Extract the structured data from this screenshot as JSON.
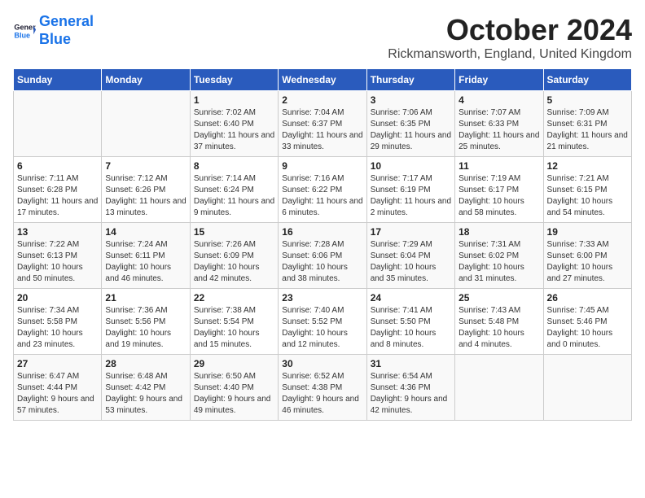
{
  "header": {
    "logo_line1": "General",
    "logo_line2": "Blue",
    "month_title": "October 2024",
    "location": "Rickmansworth, England, United Kingdom"
  },
  "weekdays": [
    "Sunday",
    "Monday",
    "Tuesday",
    "Wednesday",
    "Thursday",
    "Friday",
    "Saturday"
  ],
  "weeks": [
    [
      {
        "day": "",
        "info": ""
      },
      {
        "day": "",
        "info": ""
      },
      {
        "day": "1",
        "info": "Sunrise: 7:02 AM\nSunset: 6:40 PM\nDaylight: 11 hours and 37 minutes."
      },
      {
        "day": "2",
        "info": "Sunrise: 7:04 AM\nSunset: 6:37 PM\nDaylight: 11 hours and 33 minutes."
      },
      {
        "day": "3",
        "info": "Sunrise: 7:06 AM\nSunset: 6:35 PM\nDaylight: 11 hours and 29 minutes."
      },
      {
        "day": "4",
        "info": "Sunrise: 7:07 AM\nSunset: 6:33 PM\nDaylight: 11 hours and 25 minutes."
      },
      {
        "day": "5",
        "info": "Sunrise: 7:09 AM\nSunset: 6:31 PM\nDaylight: 11 hours and 21 minutes."
      }
    ],
    [
      {
        "day": "6",
        "info": "Sunrise: 7:11 AM\nSunset: 6:28 PM\nDaylight: 11 hours and 17 minutes."
      },
      {
        "day": "7",
        "info": "Sunrise: 7:12 AM\nSunset: 6:26 PM\nDaylight: 11 hours and 13 minutes."
      },
      {
        "day": "8",
        "info": "Sunrise: 7:14 AM\nSunset: 6:24 PM\nDaylight: 11 hours and 9 minutes."
      },
      {
        "day": "9",
        "info": "Sunrise: 7:16 AM\nSunset: 6:22 PM\nDaylight: 11 hours and 6 minutes."
      },
      {
        "day": "10",
        "info": "Sunrise: 7:17 AM\nSunset: 6:19 PM\nDaylight: 11 hours and 2 minutes."
      },
      {
        "day": "11",
        "info": "Sunrise: 7:19 AM\nSunset: 6:17 PM\nDaylight: 10 hours and 58 minutes."
      },
      {
        "day": "12",
        "info": "Sunrise: 7:21 AM\nSunset: 6:15 PM\nDaylight: 10 hours and 54 minutes."
      }
    ],
    [
      {
        "day": "13",
        "info": "Sunrise: 7:22 AM\nSunset: 6:13 PM\nDaylight: 10 hours and 50 minutes."
      },
      {
        "day": "14",
        "info": "Sunrise: 7:24 AM\nSunset: 6:11 PM\nDaylight: 10 hours and 46 minutes."
      },
      {
        "day": "15",
        "info": "Sunrise: 7:26 AM\nSunset: 6:09 PM\nDaylight: 10 hours and 42 minutes."
      },
      {
        "day": "16",
        "info": "Sunrise: 7:28 AM\nSunset: 6:06 PM\nDaylight: 10 hours and 38 minutes."
      },
      {
        "day": "17",
        "info": "Sunrise: 7:29 AM\nSunset: 6:04 PM\nDaylight: 10 hours and 35 minutes."
      },
      {
        "day": "18",
        "info": "Sunrise: 7:31 AM\nSunset: 6:02 PM\nDaylight: 10 hours and 31 minutes."
      },
      {
        "day": "19",
        "info": "Sunrise: 7:33 AM\nSunset: 6:00 PM\nDaylight: 10 hours and 27 minutes."
      }
    ],
    [
      {
        "day": "20",
        "info": "Sunrise: 7:34 AM\nSunset: 5:58 PM\nDaylight: 10 hours and 23 minutes."
      },
      {
        "day": "21",
        "info": "Sunrise: 7:36 AM\nSunset: 5:56 PM\nDaylight: 10 hours and 19 minutes."
      },
      {
        "day": "22",
        "info": "Sunrise: 7:38 AM\nSunset: 5:54 PM\nDaylight: 10 hours and 15 minutes."
      },
      {
        "day": "23",
        "info": "Sunrise: 7:40 AM\nSunset: 5:52 PM\nDaylight: 10 hours and 12 minutes."
      },
      {
        "day": "24",
        "info": "Sunrise: 7:41 AM\nSunset: 5:50 PM\nDaylight: 10 hours and 8 minutes."
      },
      {
        "day": "25",
        "info": "Sunrise: 7:43 AM\nSunset: 5:48 PM\nDaylight: 10 hours and 4 minutes."
      },
      {
        "day": "26",
        "info": "Sunrise: 7:45 AM\nSunset: 5:46 PM\nDaylight: 10 hours and 0 minutes."
      }
    ],
    [
      {
        "day": "27",
        "info": "Sunrise: 6:47 AM\nSunset: 4:44 PM\nDaylight: 9 hours and 57 minutes."
      },
      {
        "day": "28",
        "info": "Sunrise: 6:48 AM\nSunset: 4:42 PM\nDaylight: 9 hours and 53 minutes."
      },
      {
        "day": "29",
        "info": "Sunrise: 6:50 AM\nSunset: 4:40 PM\nDaylight: 9 hours and 49 minutes."
      },
      {
        "day": "30",
        "info": "Sunrise: 6:52 AM\nSunset: 4:38 PM\nDaylight: 9 hours and 46 minutes."
      },
      {
        "day": "31",
        "info": "Sunrise: 6:54 AM\nSunset: 4:36 PM\nDaylight: 9 hours and 42 minutes."
      },
      {
        "day": "",
        "info": ""
      },
      {
        "day": "",
        "info": ""
      }
    ]
  ]
}
